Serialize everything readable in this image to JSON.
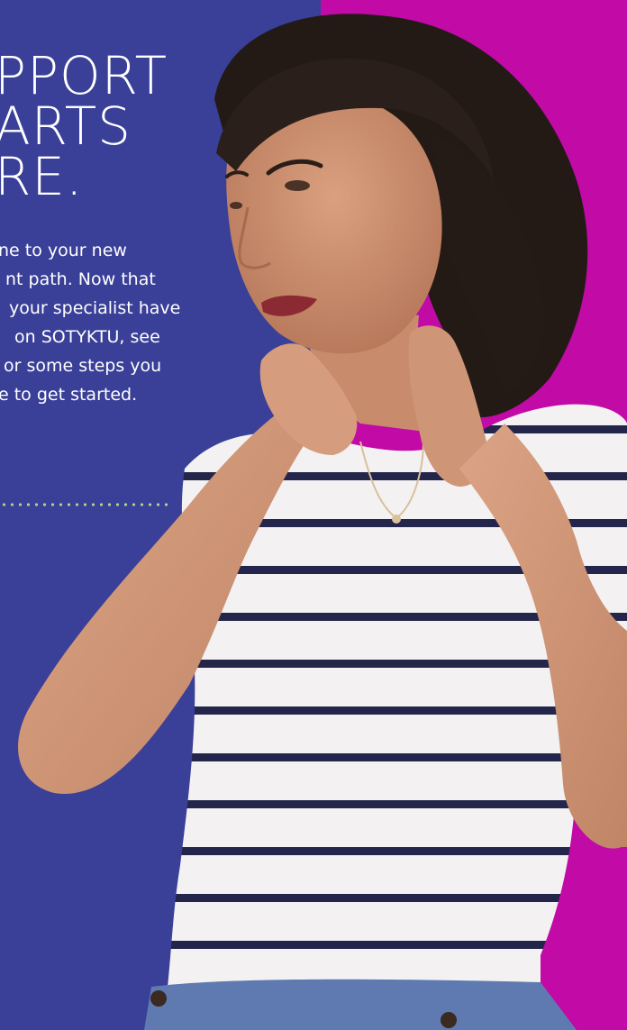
{
  "headline": {
    "lines": [
      "PPORT",
      "ARTS",
      "RE."
    ]
  },
  "body": {
    "lines": [
      "ne to your new",
      "nt path. Now that",
      "your specialist have",
      "on SOTYKTU, see",
      "or some steps you",
      "e to get started."
    ]
  },
  "colors": {
    "left_panel": "#3a3f98",
    "right_panel": "#c10aa6",
    "dotted_rule": "#a6d98a",
    "text": "#ffffff"
  },
  "photo": {
    "subject": "woman in striped t-shirt with hands at neck"
  }
}
